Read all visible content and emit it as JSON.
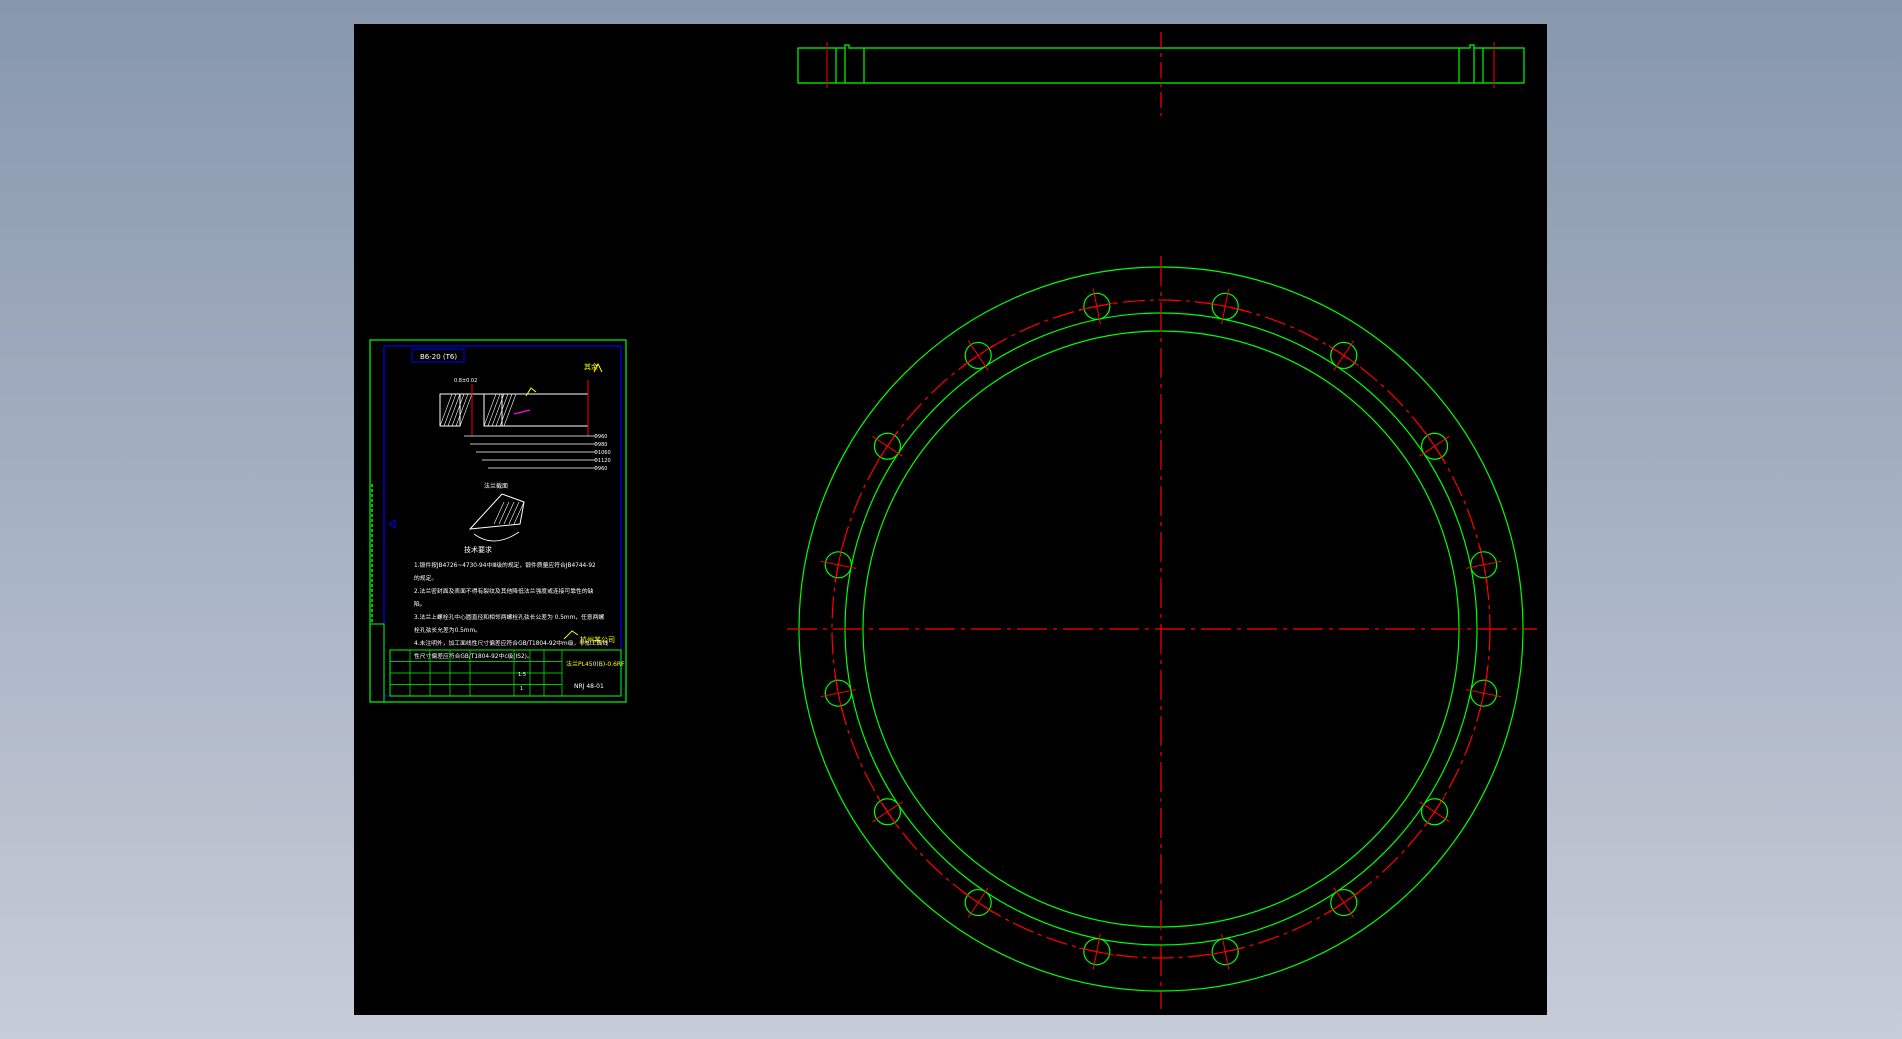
{
  "colors": {
    "background_gradient_top": "#8797ac",
    "background_gradient_bottom": "#c7ccd8",
    "viewport": "#000000",
    "outline": "#00ff00",
    "centerline": "#ff0000",
    "frame": "#0000ff",
    "annotation": "#ffffff",
    "highlight": "#ff00ff",
    "title_text": "#ffff00"
  },
  "sheet": {
    "header_label": "B6-20 (T6)",
    "roughness_note": "其余",
    "detail_label": "0.8±0.02",
    "section_title": "法兰截面",
    "dimensions": [
      "Φ960",
      "Φ980",
      "Φ1060",
      "Φ1120",
      "Φ960"
    ],
    "tech_requirements_title": "技术要求",
    "tech_requirements": [
      "1.锻件按JB4726~4730-94中Ⅲ级的规定，锻件质量应符合JB4744-92",
      "的规定。",
      "2.法兰密封面及表面不得有裂纹及其他降低法兰强度或连接可靠性的缺",
      "陷。",
      "3.法兰上螺栓孔中心圆直径和相邻两螺栓孔弦长公差为 0.5mm，任意两螺",
      "栓孔弦长允差为0.5mm。",
      "4.未注明外，加工面线性尺寸偏差应符合GB/T1804-92中m级，非加工面线",
      "性尺寸偏差应符合GB/T1804-92中c级(IS2)。"
    ],
    "title_block": {
      "part_name": "法兰PL450(B)-0.6RF",
      "drawing_no": "NRJ 48-01",
      "scale": "1:5",
      "sheet": "1",
      "company": "杭州某公司"
    }
  }
}
